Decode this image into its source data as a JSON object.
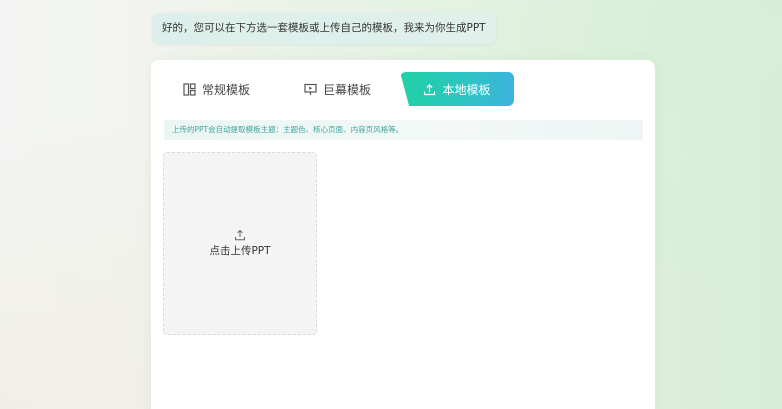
{
  "chat": {
    "message": "好的，您可以在下方选一套模板或上传自己的模板，我来为你生成PPT"
  },
  "tabs": [
    {
      "label": "常规模板",
      "icon": "layout-icon",
      "active": false
    },
    {
      "label": "巨幕模板",
      "icon": "screen-icon",
      "active": false
    },
    {
      "label": "本地模板",
      "icon": "upload-icon",
      "active": true
    }
  ],
  "notice": {
    "text": "上传的PPT会自动提取模板主题：主题色、核心页面、内容页风格等。"
  },
  "upload": {
    "label": "点击上传PPT",
    "icon": "upload-icon"
  },
  "colors": {
    "accent_start": "#1fd1a5",
    "accent_end": "#3cb4e0",
    "notice_text": "#3ea59a"
  }
}
